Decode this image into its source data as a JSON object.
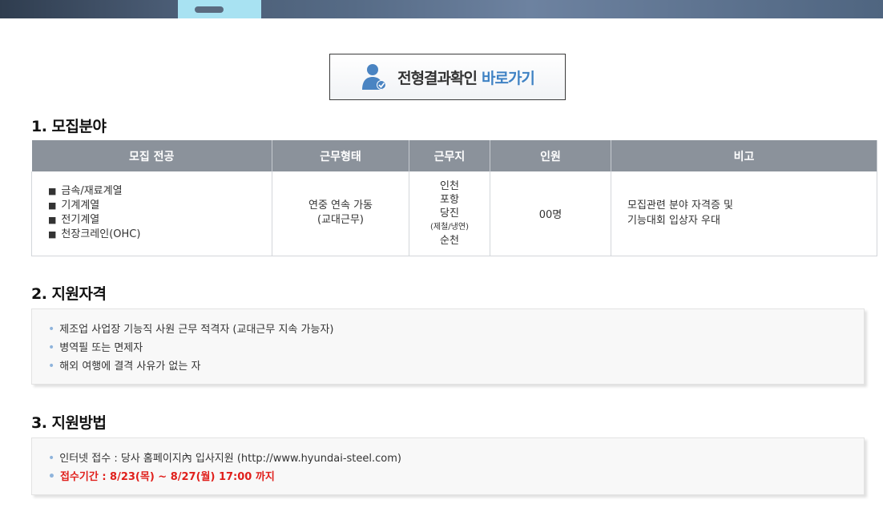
{
  "result_button": {
    "label": "전형결과확인",
    "accent": "바로가기",
    "icon": "person-check-icon",
    "accent_color": "#3f82c4"
  },
  "sections": {
    "recruit": {
      "title": "1. 모집분야"
    },
    "qualify": {
      "title": "2. 지원자격"
    },
    "method": {
      "title": "3. 지원방법"
    }
  },
  "recruit_table": {
    "headers": [
      "모집 전공",
      "근무형태",
      "근무지",
      "인원",
      "비고"
    ],
    "majors": [
      "금속/재료계열",
      "기계계열",
      "전기계열",
      "천장크레인(OHC)"
    ],
    "work_type": [
      "연중 연속 가동",
      "(교대근무)"
    ],
    "locations": [
      "인천",
      "포항",
      "당진",
      "(제철/냉연)",
      "순천"
    ],
    "headcount": "00명",
    "notes": [
      "모집관련 분야 자격증 및",
      "기능대회 입상자 우대"
    ]
  },
  "qualifications": [
    "제조업 사업장 기능직 사원 근무 적격자 (교대근무 지속 가능자)",
    "병역필 또는 면제자",
    "해외 여행에 결격 사유가 없는 자"
  ],
  "methods": [
    "인터넷 접수 : 당사 홈페이지內 입사지원 (http://www.hyundai-steel.com)",
    "접수기간 : 8/23(목) ~ 8/27(월) 17:00 까지"
  ],
  "colors": {
    "table_header": "#8b929b",
    "deadline": "#e0201c",
    "bullet": "#8fb4dc"
  }
}
